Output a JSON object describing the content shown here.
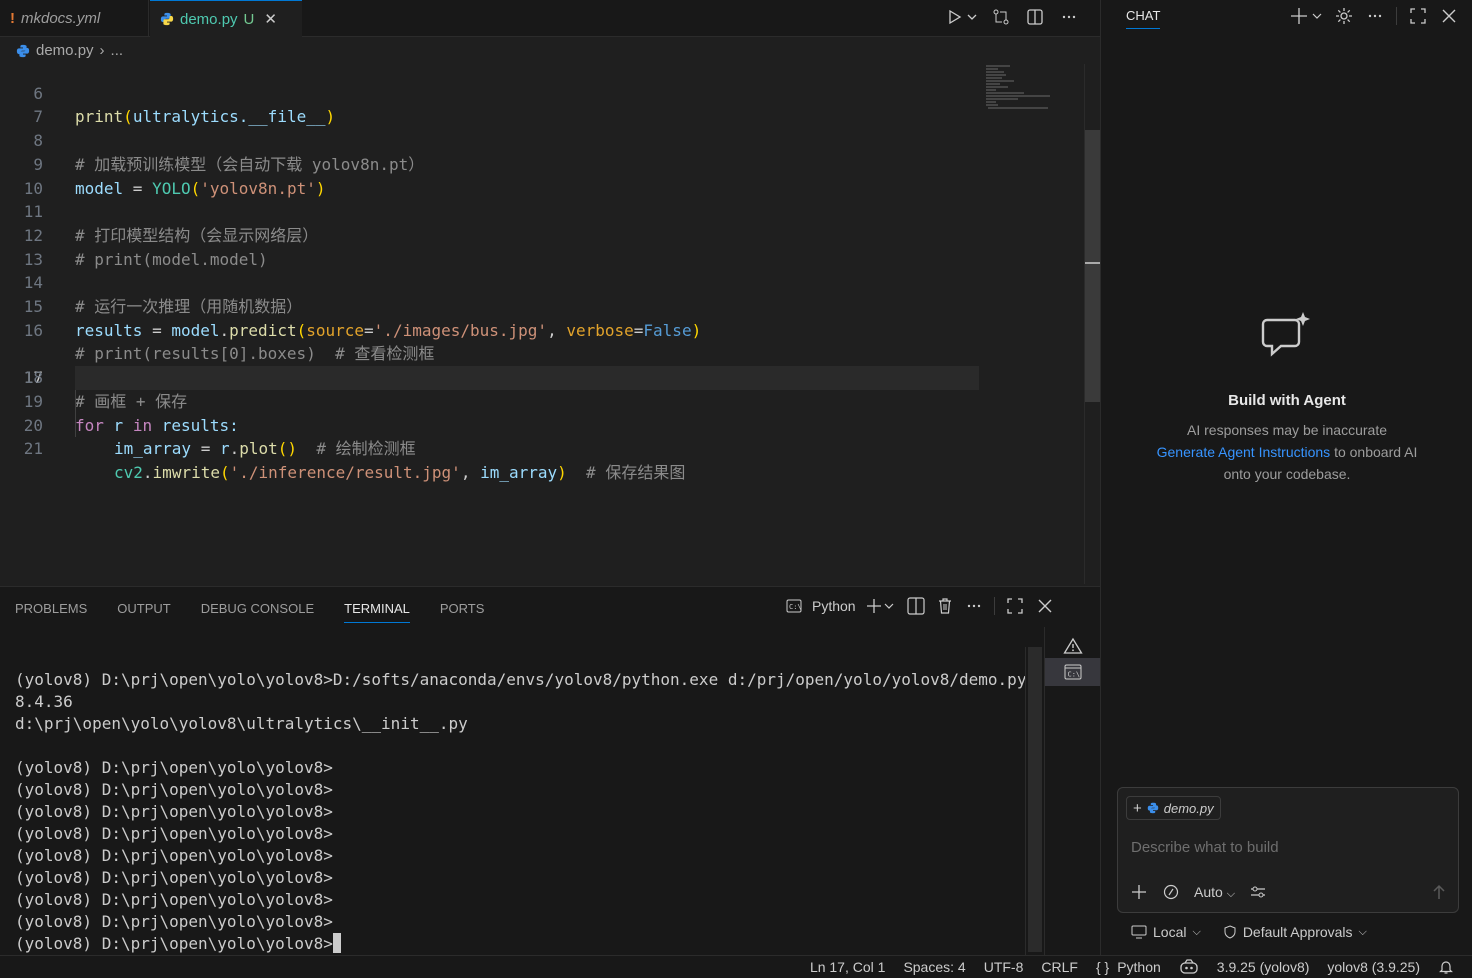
{
  "tabs": [
    {
      "label": "mkdocs.yml",
      "icon": "yaml-icon",
      "marker": "!"
    },
    {
      "label": "demo.py",
      "icon": "python-icon",
      "status": "U"
    }
  ],
  "breadcrumb": {
    "file": "demo.py",
    "more": "..."
  },
  "code": {
    "lines": [
      {
        "n": "6"
      },
      {
        "n": "7"
      },
      {
        "n": "8"
      },
      {
        "n": "9"
      },
      {
        "n": "10"
      },
      {
        "n": "11"
      },
      {
        "n": "12"
      },
      {
        "n": "13"
      },
      {
        "n": "14"
      },
      {
        "n": "15"
      },
      {
        "n": "16"
      },
      {
        "n": "17"
      },
      {
        "n": "18"
      },
      {
        "n": "19"
      },
      {
        "n": "20"
      },
      {
        "n": "21"
      }
    ],
    "l6": {
      "a": "print",
      "b": "(",
      "c": "ultralytics",
      "d": ".__file__",
      "e": ")"
    },
    "l8": "# 加载预训练模型（会自动下载 yolov8n.pt）",
    "l9": {
      "a": "model",
      "b": " = ",
      "c": "YOLO",
      "d": "(",
      "e": "'yolov8n.pt'",
      "f": ")"
    },
    "l11": "# 打印模型结构（会显示网络层）",
    "l12": "# print(model.model)",
    "l14": "# 运行一次推理（用随机数据）",
    "l15": {
      "a": "results",
      "b": " = ",
      "c": "model",
      "d": ".",
      "e": "predict",
      "f": "(",
      "g": "source",
      "h": "=",
      "i": "'./images/bus.jpg'",
      "j": ", ",
      "k": "verbose",
      "l": "=",
      "m": "False",
      "n": ")"
    },
    "l16": "# print(results[0].boxes)  # 查看检测框",
    "l18": "# 画框 + 保存",
    "l19": {
      "a": "for",
      "b": " r ",
      "c": "in",
      "d": " results:"
    },
    "l20": {
      "a": "im_array",
      "b": " = ",
      "c": "r",
      "d": ".",
      "e": "plot",
      "f": "()",
      "g": "  # 绘制检测框"
    },
    "l21": {
      "a": "cv2",
      "b": ".",
      "c": "imwrite",
      "d": "(",
      "e": "'./inference/result.jpg'",
      "f": ", ",
      "g": "im_array",
      "h": ")",
      "i": "  # 保存结果图"
    }
  },
  "panel": {
    "tabs": [
      "PROBLEMS",
      "OUTPUT",
      "DEBUG CONSOLE",
      "TERMINAL",
      "PORTS"
    ],
    "active_tab": "TERMINAL",
    "shell": "Python"
  },
  "terminal": {
    "lines": [
      "(yolov8) D:\\prj\\open\\yolo\\yolov8>D:/softs/anaconda/envs/yolov8/python.exe d:/prj/open/yolo/yolov8/demo.py",
      "8.4.36",
      "d:\\prj\\open\\yolo\\yolov8\\ultralytics\\__init__.py",
      "",
      "(yolov8) D:\\prj\\open\\yolo\\yolov8>",
      "(yolov8) D:\\prj\\open\\yolo\\yolov8>",
      "(yolov8) D:\\prj\\open\\yolo\\yolov8>",
      "(yolov8) D:\\prj\\open\\yolo\\yolov8>",
      "(yolov8) D:\\prj\\open\\yolo\\yolov8>",
      "(yolov8) D:\\prj\\open\\yolo\\yolov8>",
      "(yolov8) D:\\prj\\open\\yolo\\yolov8>",
      "(yolov8) D:\\prj\\open\\yolo\\yolov8>",
      "(yolov8) D:\\prj\\open\\yolo\\yolov8>"
    ]
  },
  "chat": {
    "title": "CHAT",
    "heading": "Build with Agent",
    "disclaimer": "AI responses may be inaccurate",
    "link": "Generate Agent Instructions",
    "link_suffix": " to onboard AI",
    "link_suffix2": "onto your codebase.",
    "context_file": "demo.py",
    "placeholder": "Describe what to build",
    "mode": "Auto",
    "location": "Local",
    "approvals": "Default Approvals"
  },
  "statusbar": {
    "position": "Ln 17, Col 1",
    "spaces": "Spaces: 4",
    "encoding": "UTF-8",
    "eol": "CRLF",
    "language": "Python",
    "interpreter": "3.9.25 (yolov8)",
    "env": "yolov8 (3.9.25)"
  },
  "colors": {
    "accent": "#0078d4",
    "link": "#3794ff",
    "python_icon": "#3b8eea"
  }
}
